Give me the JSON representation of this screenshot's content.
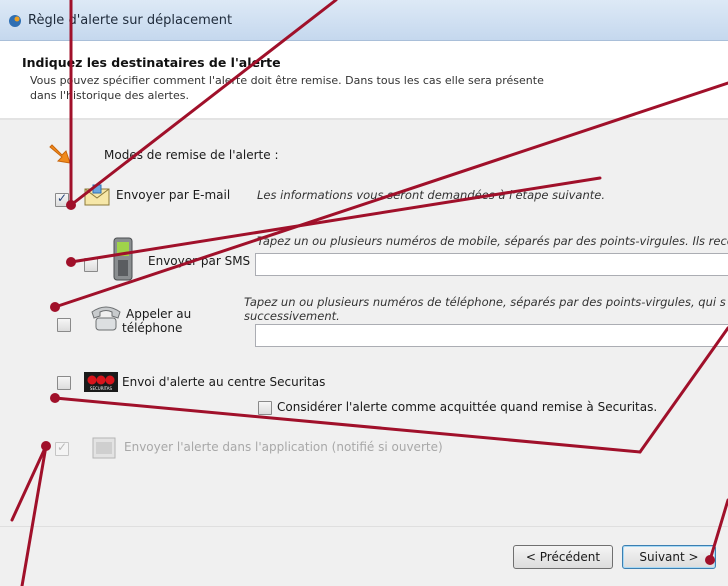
{
  "window": {
    "title": "Règle d'alerte sur déplacement"
  },
  "header": {
    "title": "Indiquez les destinataires de l'alerte",
    "description": "Vous pouvez spécifier comment l'alerte doit être remise. Dans tous les cas elle sera présente dans l'historique des alertes."
  },
  "modes": {
    "label": "Modes de remise de l'alerte :",
    "email": {
      "label": "Envoyer par E-mail",
      "checked": true,
      "hint": "Les informations vous seront demandées à l'étape suivante."
    },
    "sms": {
      "label": "Envoyer par SMS",
      "checked": false,
      "hint": "Tapez un ou plusieurs numéros de mobile, séparés par des points-virgules. Ils recev",
      "value": ""
    },
    "phone": {
      "label_line1": "Appeler au",
      "label_line2": "téléphone",
      "checked": false,
      "hint_line1": "Tapez un ou plusieurs numéros de téléphone, séparés par des points-virgules, qui s",
      "hint_line2": "successivement.",
      "value": ""
    },
    "securitas": {
      "label": "Envoi d'alerte au centre Securitas",
      "checked": false,
      "sub_label": "Considérer l'alerte comme acquittée quand remise à Securitas.",
      "sub_checked": false,
      "logo_text": "SECURITAS"
    },
    "app": {
      "label": "Envoyer l'alerte dans l'application (notifié si ouverte)",
      "checked": true,
      "disabled": true
    }
  },
  "buttons": {
    "previous": "< Précédent",
    "next": "Suivant >"
  },
  "colors": {
    "annotation": "#a0102a",
    "accent": "#3c7fb1"
  }
}
